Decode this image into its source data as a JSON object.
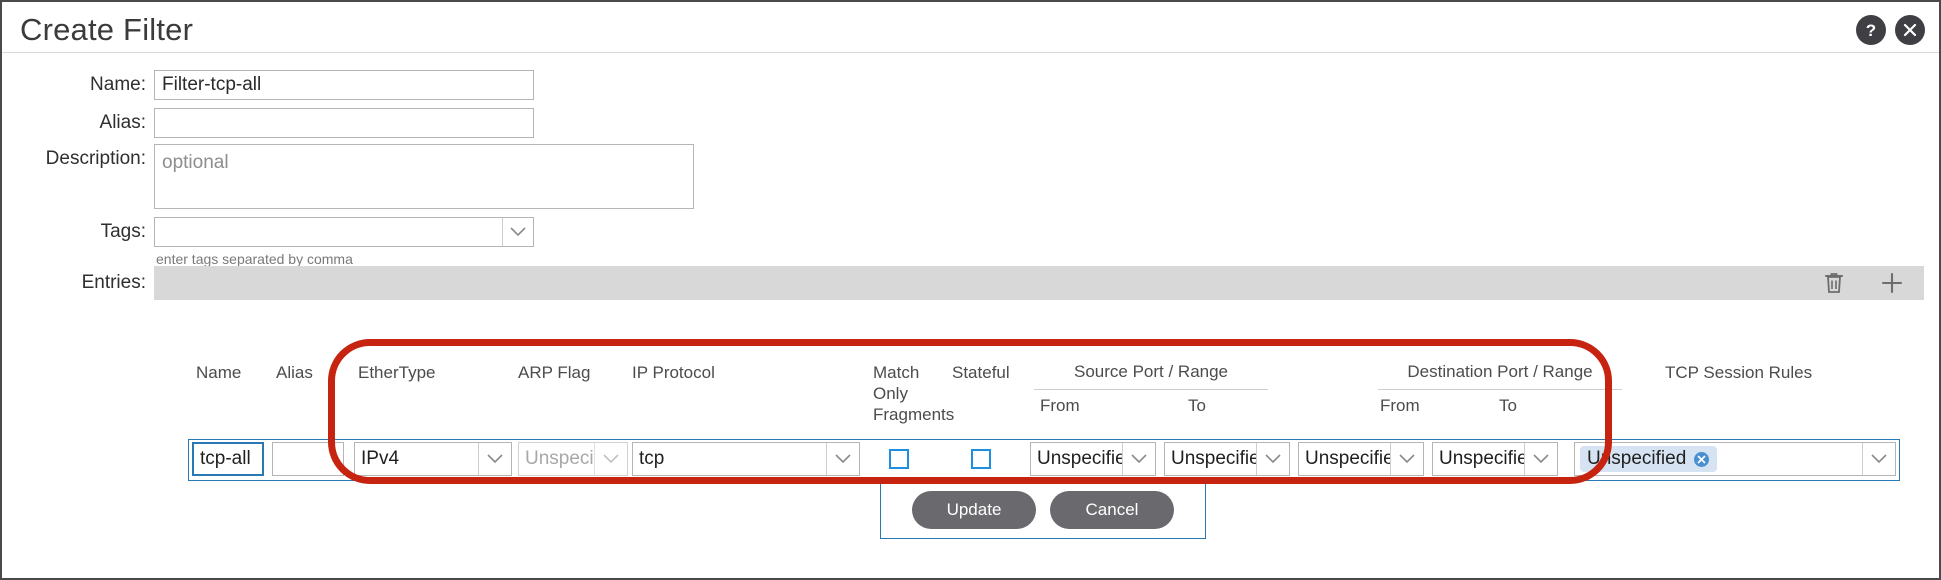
{
  "dialog": {
    "title": "Create Filter",
    "help_icon": "help-icon",
    "close_icon": "close-icon"
  },
  "form": {
    "name": {
      "label": "Name:",
      "value": "Filter-tcp-all",
      "placeholder": ""
    },
    "alias": {
      "label": "Alias:",
      "value": "",
      "placeholder": ""
    },
    "description": {
      "label": "Description:",
      "value": "",
      "placeholder": "optional"
    },
    "tags": {
      "label": "Tags:",
      "value": "",
      "placeholder": "",
      "hint": "enter tags separated by comma"
    },
    "entries": {
      "label": "Entries:"
    }
  },
  "toolbar": {
    "delete_icon": "trash-icon",
    "add_icon": "plus-icon"
  },
  "table": {
    "headers": {
      "name": "Name",
      "alias": "Alias",
      "ethertype": "EtherType",
      "arp_flag": "ARP Flag",
      "ip_protocol": "IP Protocol",
      "match_only_fragments": "Match Only Fragments",
      "stateful": "Stateful",
      "source_port_range": "Source Port / Range",
      "destination_port_range": "Destination Port / Range",
      "tcp_session_rules": "TCP Session Rules",
      "from": "From",
      "to": "To"
    },
    "row": {
      "name": "tcp-all",
      "alias": "",
      "ethertype": "IPv4",
      "arp_flag": "Unspecif",
      "ip_protocol": "tcp",
      "match_only_fragments_checked": false,
      "stateful_checked": false,
      "source_from": "Unspecifie",
      "source_to": "Unspecifie",
      "destination_from": "Unspecifie",
      "destination_to": "Unspecifie",
      "tcp_session_rules_chip": "Unspecified"
    }
  },
  "actions": {
    "update_label": "Update",
    "cancel_label": "Cancel"
  },
  "colors": {
    "accent_blue": "#2878b4",
    "checkbox_blue": "#1e8fe0",
    "annotation_red": "#c62411",
    "toolbar_gray": "#d8d8d8",
    "button_gray": "#6a6a6e"
  }
}
